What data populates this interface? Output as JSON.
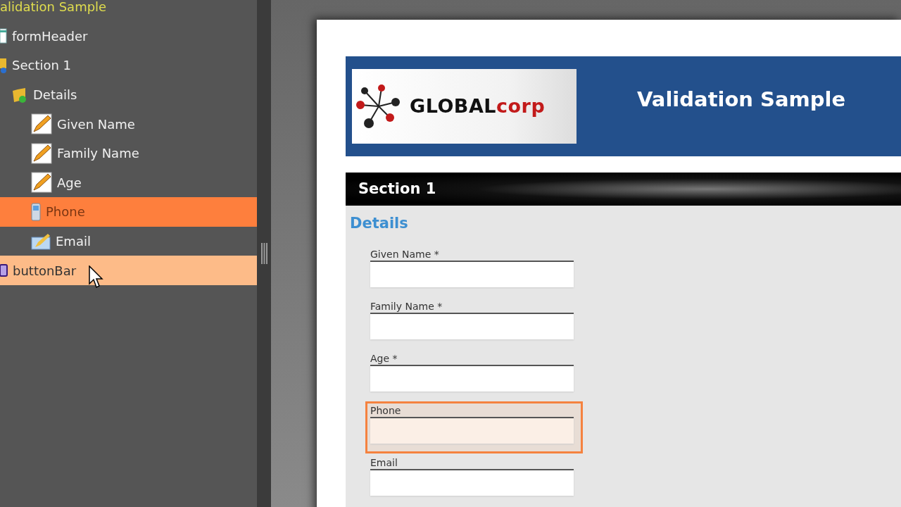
{
  "tree": {
    "label": "alidation Sample",
    "selected": false,
    "hovered": false,
    "children": [
      {
        "label": "formHeader",
        "kind": "header",
        "selected": false,
        "hovered": false
      },
      {
        "label": "Section 1",
        "kind": "section",
        "selected": false,
        "hovered": false,
        "children": [
          {
            "label": "Details",
            "kind": "group",
            "selected": false,
            "hovered": false,
            "children": [
              {
                "label": "Given Name",
                "kind": "text-field",
                "selected": false,
                "hovered": false
              },
              {
                "label": "Family Name",
                "kind": "text-field",
                "selected": false,
                "hovered": false
              },
              {
                "label": "Age",
                "kind": "text-field",
                "selected": false,
                "hovered": false
              },
              {
                "label": "Phone",
                "kind": "phone-field",
                "selected": true,
                "hovered": false
              },
              {
                "label": "Email",
                "kind": "email-field",
                "selected": false,
                "hovered": false
              }
            ]
          }
        ]
      },
      {
        "label": "buttonBar",
        "kind": "button-bar",
        "selected": false,
        "hovered": true
      }
    ]
  },
  "form": {
    "logo": {
      "word": "GLOBAL",
      "suffix": "corp"
    },
    "title": "Validation Sample",
    "section": "Section 1",
    "group": "Details",
    "fields": [
      {
        "label": "Given Name *",
        "highlighted": false
      },
      {
        "label": "Family Name *",
        "highlighted": false
      },
      {
        "label": "Age *",
        "highlighted": false
      },
      {
        "label": "Phone",
        "highlighted": true
      },
      {
        "label": "Email",
        "highlighted": false
      }
    ]
  }
}
